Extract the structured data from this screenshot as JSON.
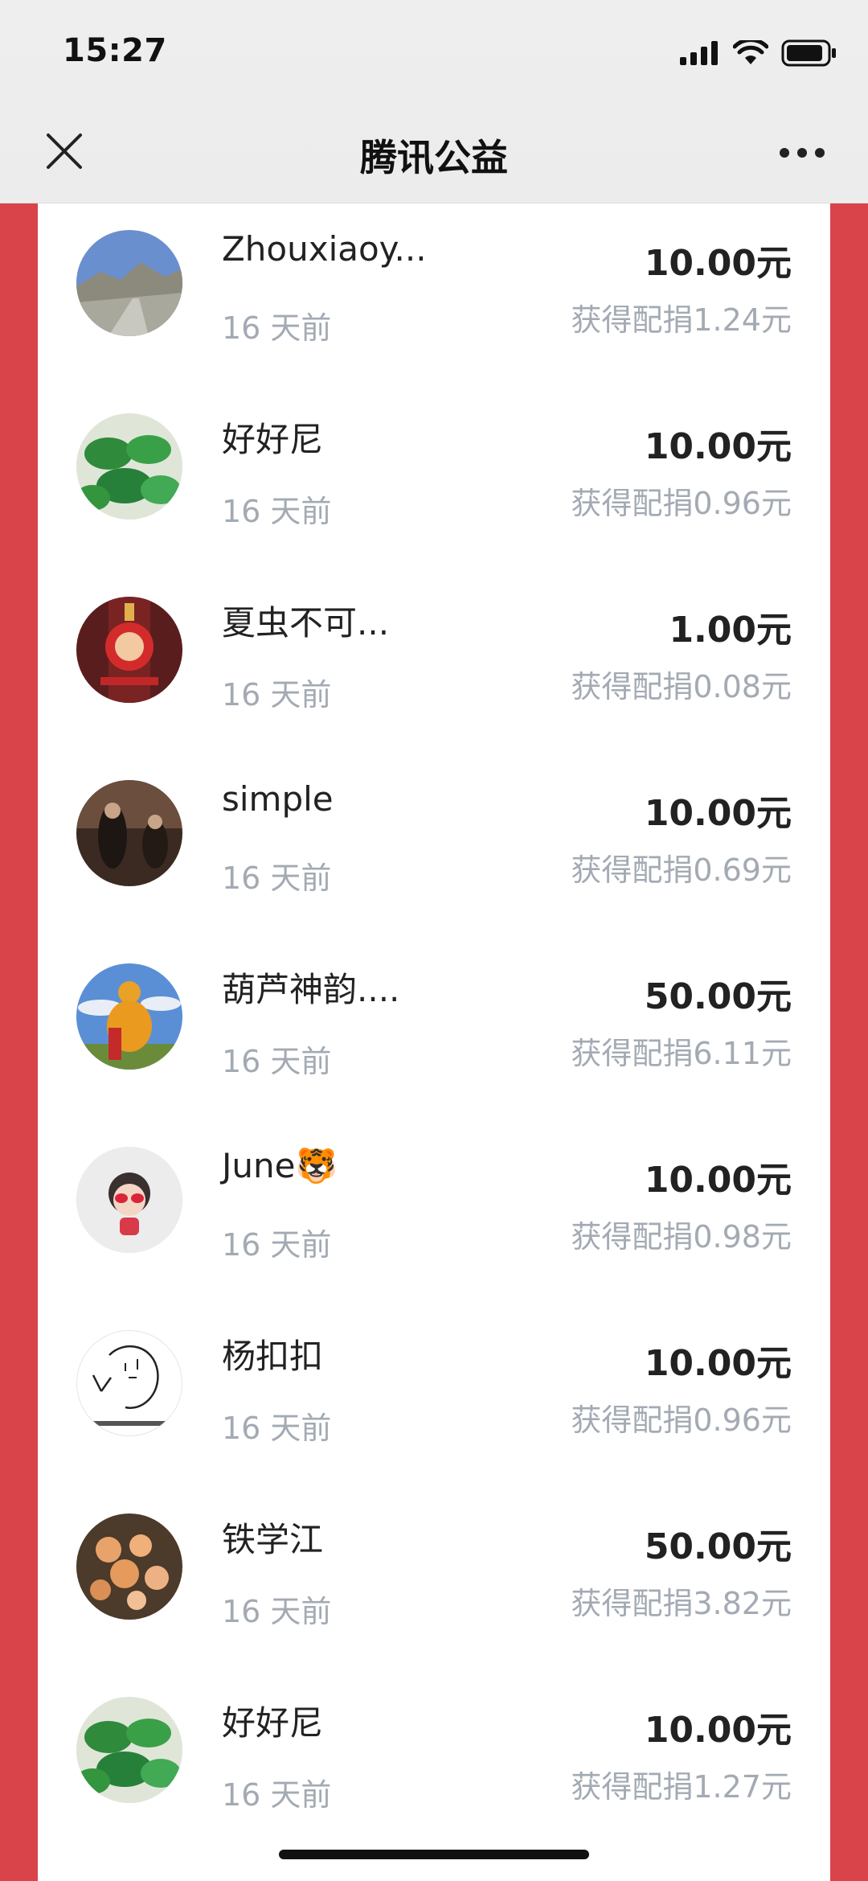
{
  "status_bar": {
    "time": "15:27"
  },
  "nav": {
    "title": "腾讯公益",
    "close_icon": "close-icon",
    "more_icon": "more-icon"
  },
  "colors": {
    "page_red": "#d9434a",
    "muted_text": "#a3aab3"
  },
  "donations": [
    {
      "name": "Zhouxiaoy...",
      "time": "16 天前",
      "amount": "10.00元",
      "match": "获得配捐1.24元",
      "avatar": "mountain-road"
    },
    {
      "name": "好好尼",
      "time": "16 天前",
      "amount": "10.00元",
      "match": "获得配捐0.96元",
      "avatar": "green-leaves"
    },
    {
      "name": "夏虫不可...",
      "time": "16 天前",
      "amount": "1.00元",
      "match": "获得配捐0.08元",
      "avatar": "red-lantern"
    },
    {
      "name": "simple",
      "time": "16 天前",
      "amount": "10.00元",
      "match": "获得配捐0.69元",
      "avatar": "dim-figures"
    },
    {
      "name": "葫芦神韵....",
      "time": "16 天前",
      "amount": "50.00元",
      "match": "获得配捐6.11元",
      "avatar": "gourd-sky"
    },
    {
      "name": "June🐯",
      "time": "16 天前",
      "amount": "10.00元",
      "match": "获得配捐0.98元",
      "avatar": "cartoon-girl"
    },
    {
      "name": "杨扣扣",
      "time": "16 天前",
      "amount": "10.00元",
      "match": "获得配捐0.96元",
      "avatar": "sketch-doodle"
    },
    {
      "name": "铁学江",
      "time": "16 天前",
      "amount": "50.00元",
      "match": "获得配捐3.82元",
      "avatar": "orange-flowers"
    },
    {
      "name": "好好尼",
      "time": "16 天前",
      "amount": "10.00元",
      "match": "获得配捐1.27元",
      "avatar": "green-leaves"
    }
  ]
}
